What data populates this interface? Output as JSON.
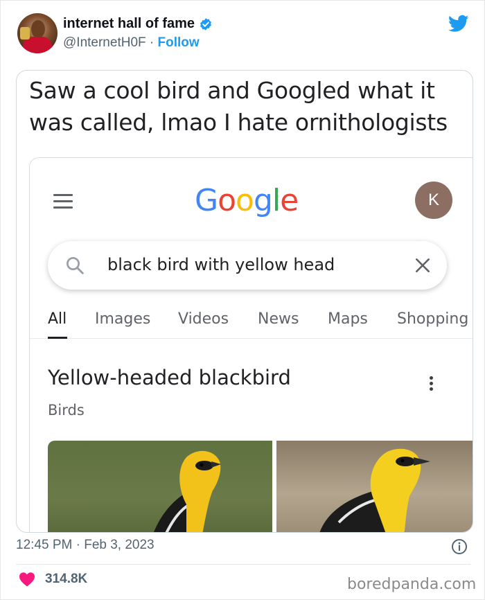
{
  "author": {
    "display_name": "internet hall of fame",
    "handle": "@InternetH0F",
    "separator": "·",
    "follow_label": "Follow"
  },
  "tweet": {
    "caption": "Saw a cool bird and Googled what it was called, lmao I hate ornithologists",
    "timestamp": "12:45 PM · Feb 3, 2023",
    "like_count": "314.8K"
  },
  "google": {
    "logo_letters": [
      "G",
      "o",
      "o",
      "g",
      "l",
      "e"
    ],
    "account_initial": "K",
    "search_query": "black bird with yellow head",
    "tabs": [
      "All",
      "Images",
      "Videos",
      "News",
      "Maps",
      "Shopping"
    ],
    "active_tab": "All",
    "result_title": "Yellow-headed blackbird",
    "result_subtitle": "Birds"
  },
  "watermark": "boredpanda.com",
  "colors": {
    "twitter_blue": "#1d9bf0",
    "like_pink": "#f91880",
    "google_blue": "#4285f4",
    "google_red": "#ea4335",
    "google_yellow": "#fbbc05",
    "google_green": "#34a853"
  }
}
